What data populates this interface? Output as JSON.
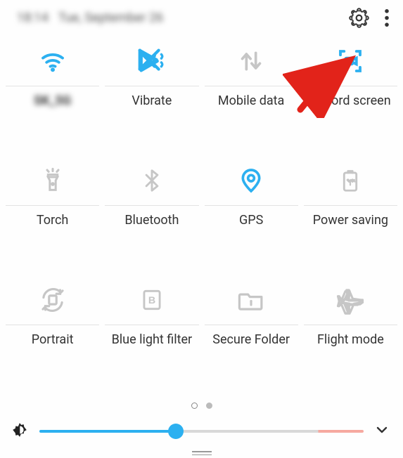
{
  "status": {
    "time": "18:14",
    "date": "Tue, September 26"
  },
  "colors": {
    "active": "#2cb0f0",
    "inactive": "#c6c6c6"
  },
  "tiles": [
    {
      "id": "wifi",
      "icon": "wifi-icon",
      "label": "SK_5G",
      "label_blurred": true,
      "active": true
    },
    {
      "id": "vibrate",
      "icon": "vibrate-icon",
      "label": "Vibrate",
      "label_blurred": false,
      "active": true
    },
    {
      "id": "mobile-data",
      "icon": "data-arrows-icon",
      "label": "Mobile data",
      "label_blurred": false,
      "active": false
    },
    {
      "id": "record-screen",
      "icon": "record-screen-icon",
      "label": "Record screen",
      "label_blurred": false,
      "active": true
    },
    {
      "id": "torch",
      "icon": "torch-icon",
      "label": "Torch",
      "label_blurred": false,
      "active": false
    },
    {
      "id": "bluetooth",
      "icon": "bluetooth-icon",
      "label": "Bluetooth",
      "label_blurred": false,
      "active": false
    },
    {
      "id": "gps",
      "icon": "location-pin-icon",
      "label": "GPS",
      "label_blurred": false,
      "active": true
    },
    {
      "id": "power-saving",
      "icon": "battery-save-icon",
      "label": "Power saving",
      "label_blurred": false,
      "active": false
    },
    {
      "id": "portrait",
      "icon": "rotation-lock-icon",
      "label": "Portrait",
      "label_blurred": false,
      "active": false
    },
    {
      "id": "blue-light",
      "icon": "blue-light-icon",
      "label": "Blue light filter",
      "label_blurred": false,
      "active": false
    },
    {
      "id": "secure-folder",
      "icon": "secure-folder-icon",
      "label": "Secure Folder",
      "label_blurred": false,
      "active": false
    },
    {
      "id": "flight-mode",
      "icon": "airplane-icon",
      "label": "Flight mode",
      "label_blurred": false,
      "active": false
    }
  ],
  "pager": {
    "pages": 2,
    "current": 0
  },
  "brightness": {
    "value": 42,
    "max": 100,
    "warn_threshold": 86
  }
}
